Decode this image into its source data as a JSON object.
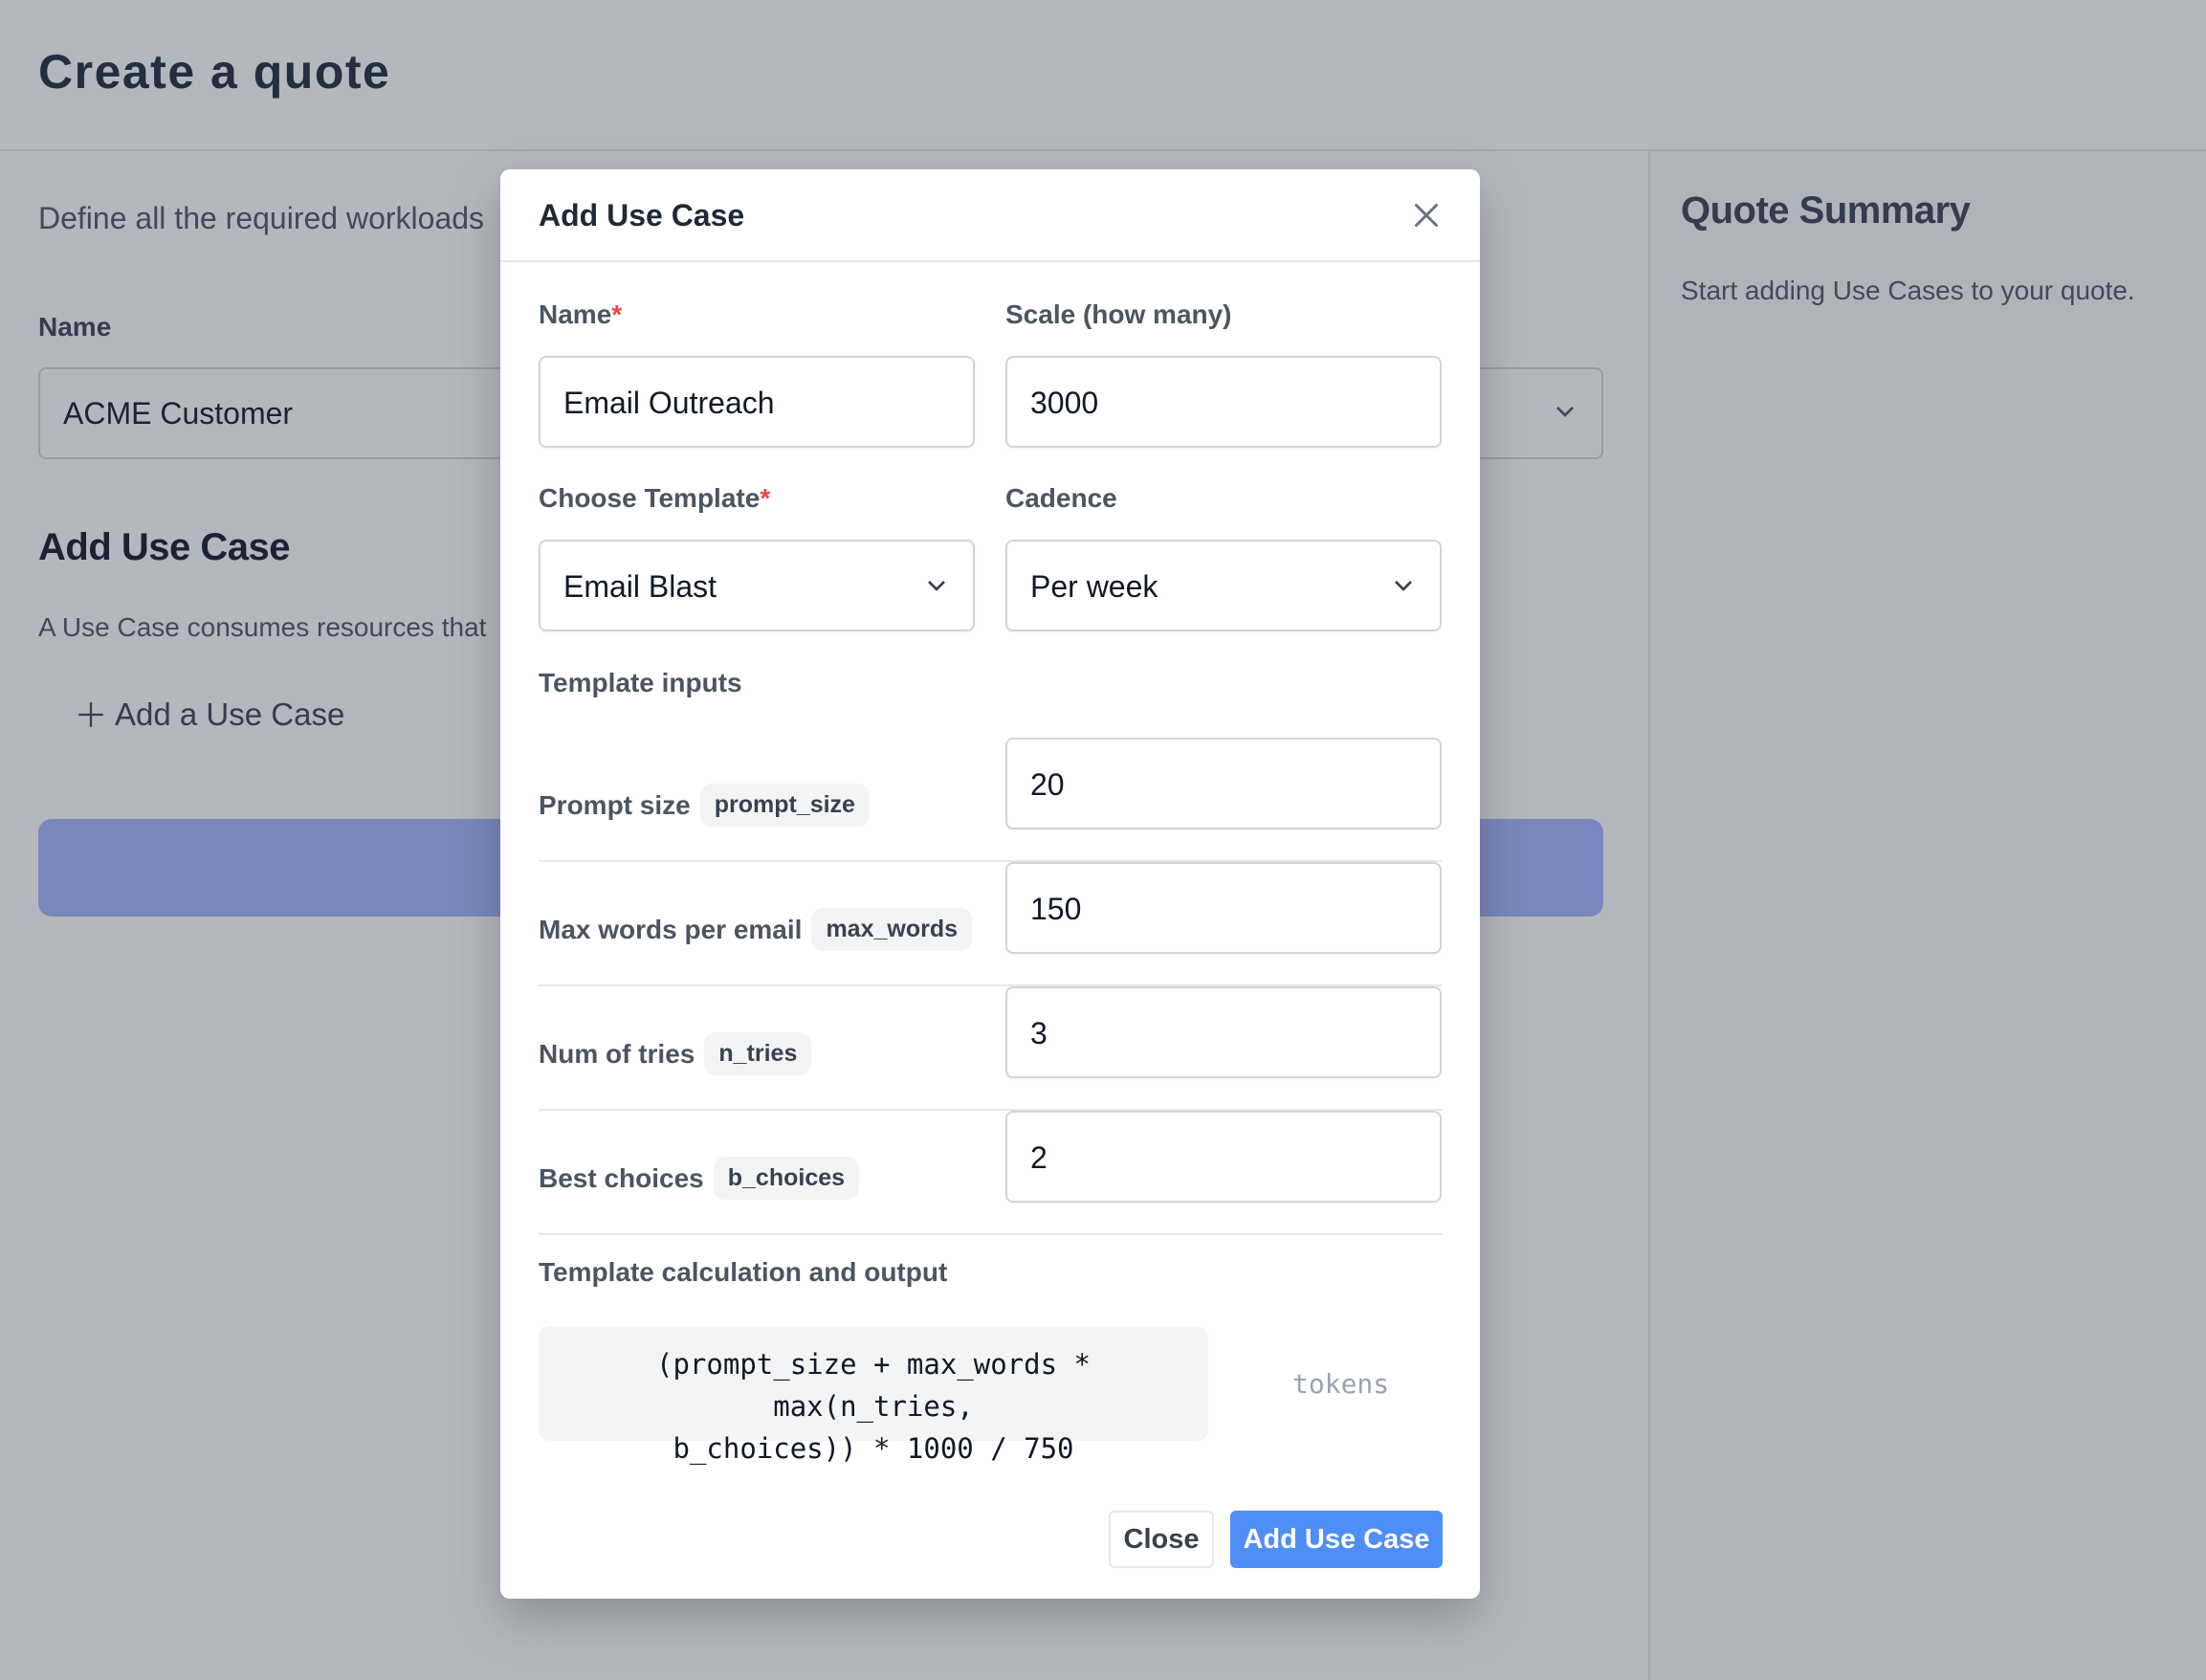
{
  "page": {
    "title": "Create a quote",
    "intro": "Define all the required workloads",
    "name_label": "Name",
    "name_value": "ACME Customer",
    "section_title": "Add Use Case",
    "section_desc": "A Use Case consumes resources that",
    "add_link": "Add a Use Case"
  },
  "sidebar": {
    "title": "Quote Summary",
    "text": "Start adding Use Cases to your quote."
  },
  "modal": {
    "title": "Add Use Case",
    "name_label": "Name",
    "name_value": "Email Outreach",
    "scale_label": "Scale (how many)",
    "scale_value": "3000",
    "template_label": "Choose Template",
    "template_value": "Email Blast",
    "cadence_label": "Cadence",
    "cadence_value": "Per week",
    "required_marker": "*",
    "template_inputs_label": "Template inputs",
    "params": [
      {
        "label": "Prompt size",
        "key": "prompt_size",
        "value": "20"
      },
      {
        "label": "Max words per email",
        "key": "max_words",
        "value": "150"
      },
      {
        "label": "Num of tries",
        "key": "n_tries",
        "value": "3"
      },
      {
        "label": "Best choices",
        "key": "b_choices",
        "value": "2"
      }
    ],
    "calc_label": "Template calculation and output",
    "formula_line1": "(prompt_size + max_words * max(n_tries,",
    "formula_line2": "b_choices)) * 1000 / 750",
    "output_unit": "tokens",
    "close_button": "Close",
    "add_button": "Add Use Case"
  },
  "colors": {
    "accent": "#4f8ef7",
    "required": "#ef4444",
    "overlay": "rgba(44,56,74,0.36)"
  },
  "icons": {
    "close": "close-icon",
    "chevron": "chevron-down-icon",
    "plus": "plus-icon"
  }
}
